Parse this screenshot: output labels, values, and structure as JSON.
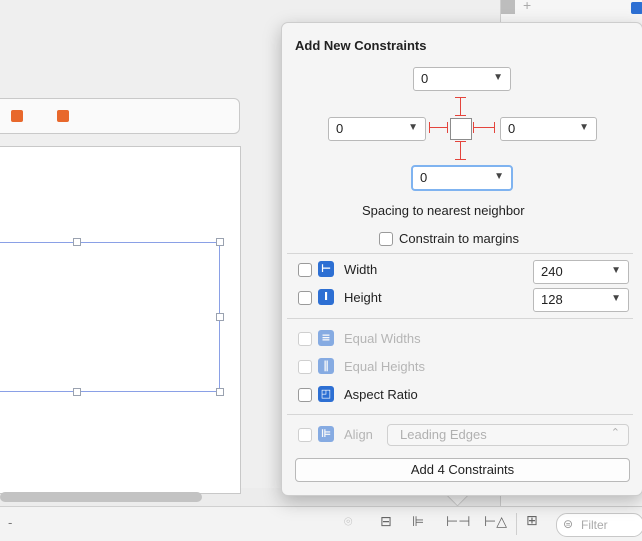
{
  "popover": {
    "title": "Add New Constraints",
    "top_spacing": "0",
    "left_spacing": "0",
    "right_spacing": "0",
    "bottom_spacing": "0",
    "spacing_label": "Spacing to nearest neighbor",
    "constrain_margins": "Constrain to margins",
    "width_label": "Width",
    "width_value": "240",
    "height_label": "Height",
    "height_value": "128",
    "equal_widths": "Equal Widths",
    "equal_heights": "Equal Heights",
    "aspect_ratio": "Aspect Ratio",
    "align_label": "Align",
    "align_value": "Leading Edges",
    "add_button": "Add 4 Constraints"
  },
  "bottom_bar": {
    "left_glyph": "-",
    "filter_placeholder": "Filter"
  },
  "right_panel": {
    "plus": "+"
  },
  "colors": {
    "accent_blue": "#2d6fd3",
    "constraint_red": "#e4443c",
    "selection_blue": "#8aa0e6",
    "object_orange": "#e8682c"
  }
}
